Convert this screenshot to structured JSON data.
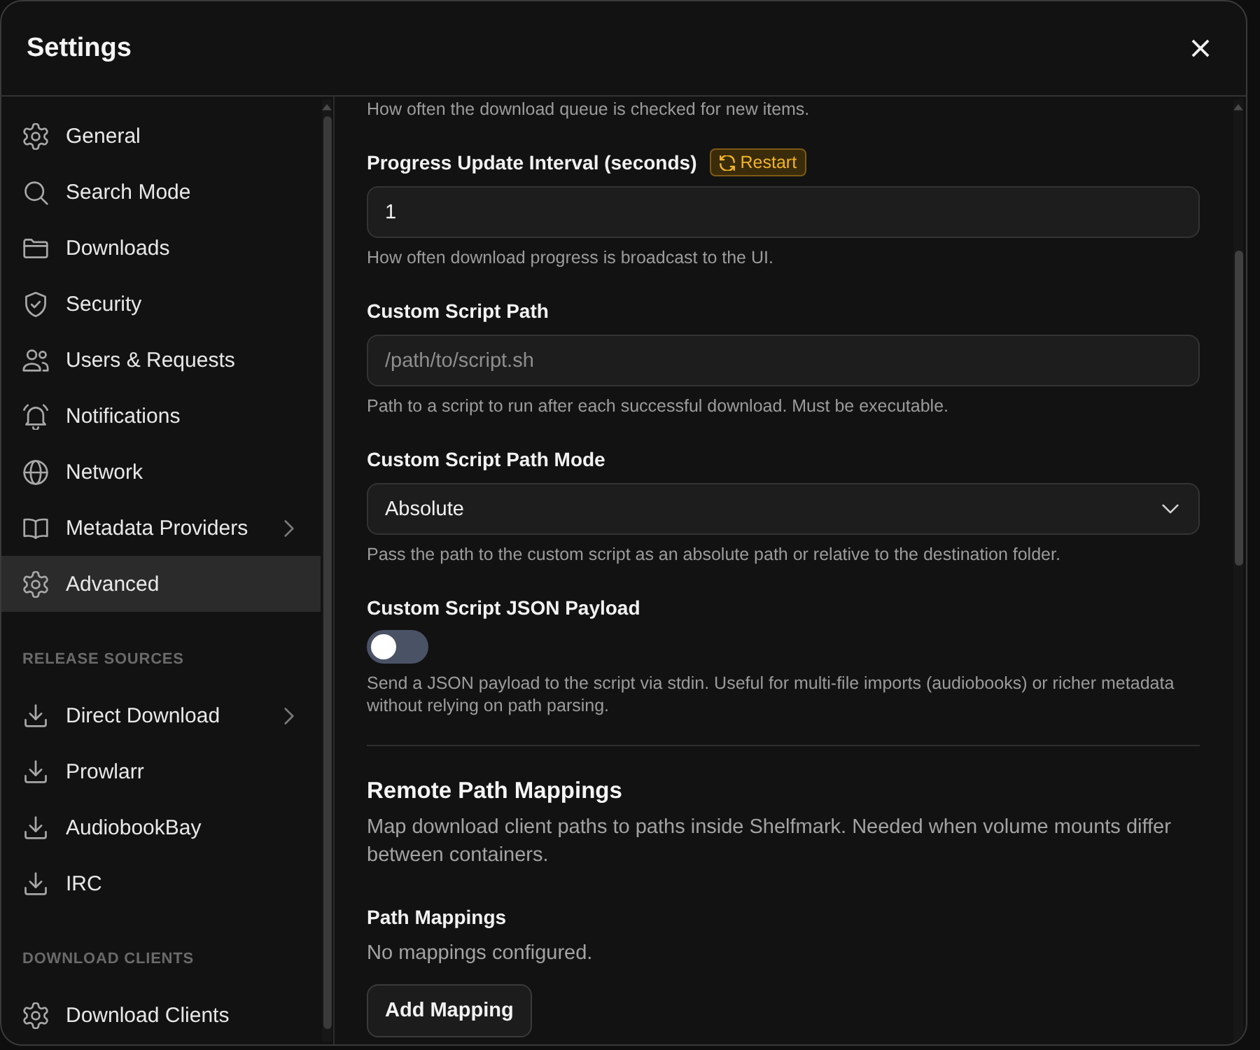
{
  "dialog": {
    "title": "Settings"
  },
  "sidebar": {
    "sections": [
      {
        "items": [
          {
            "label": "General",
            "selected": false,
            "expandable": false
          },
          {
            "label": "Search Mode",
            "selected": false,
            "expandable": false
          },
          {
            "label": "Downloads",
            "selected": false,
            "expandable": false
          },
          {
            "label": "Security",
            "selected": false,
            "expandable": false
          },
          {
            "label": "Users & Requests",
            "selected": false,
            "expandable": false
          },
          {
            "label": "Notifications",
            "selected": false,
            "expandable": false
          },
          {
            "label": "Network",
            "selected": false,
            "expandable": false
          },
          {
            "label": "Metadata Providers",
            "selected": false,
            "expandable": true
          },
          {
            "label": "Advanced",
            "selected": true,
            "expandable": false
          }
        ]
      },
      {
        "heading": "RELEASE SOURCES",
        "items": [
          {
            "label": "Direct Download",
            "selected": false,
            "expandable": true
          },
          {
            "label": "Prowlarr",
            "selected": false,
            "expandable": false
          },
          {
            "label": "AudiobookBay",
            "selected": false,
            "expandable": false
          },
          {
            "label": "IRC",
            "selected": false,
            "expandable": false
          }
        ]
      },
      {
        "heading": "DOWNLOAD CLIENTS",
        "items": [
          {
            "label": "Download Clients",
            "selected": false,
            "expandable": false
          }
        ]
      }
    ]
  },
  "settings": {
    "note": "How often the download queue is checked for new items.",
    "fields": [
      {
        "kind": "number",
        "label": "Progress Update Interval (seconds)",
        "badge": "Restart",
        "value": "1",
        "help": "How often download progress is broadcast to the UI."
      },
      {
        "kind": "text",
        "label": "Custom Script Path",
        "placeholder": "/path/to/script.sh",
        "help": "Path to a script to run after each successful download. Must be executable."
      },
      {
        "kind": "select",
        "label": "Custom Script Path Mode",
        "value": "Absolute",
        "help": "Pass the path to the custom script as an absolute path or relative to the destination folder."
      },
      {
        "kind": "toggle",
        "label": "Custom Script JSON Payload",
        "on": false,
        "help": "Send a JSON payload to the script via stdin. Useful for multi-file imports (audiobooks) or richer metadata without relying on path parsing."
      }
    ]
  },
  "mappings": {
    "title": "Remote Path Mappings",
    "description": "Map download client paths to paths inside Shelfmark. Needed when volume mounts differ between containers.",
    "label": "Path Mappings",
    "empty_text": "No mappings configured.",
    "button": "Add Mapping"
  }
}
